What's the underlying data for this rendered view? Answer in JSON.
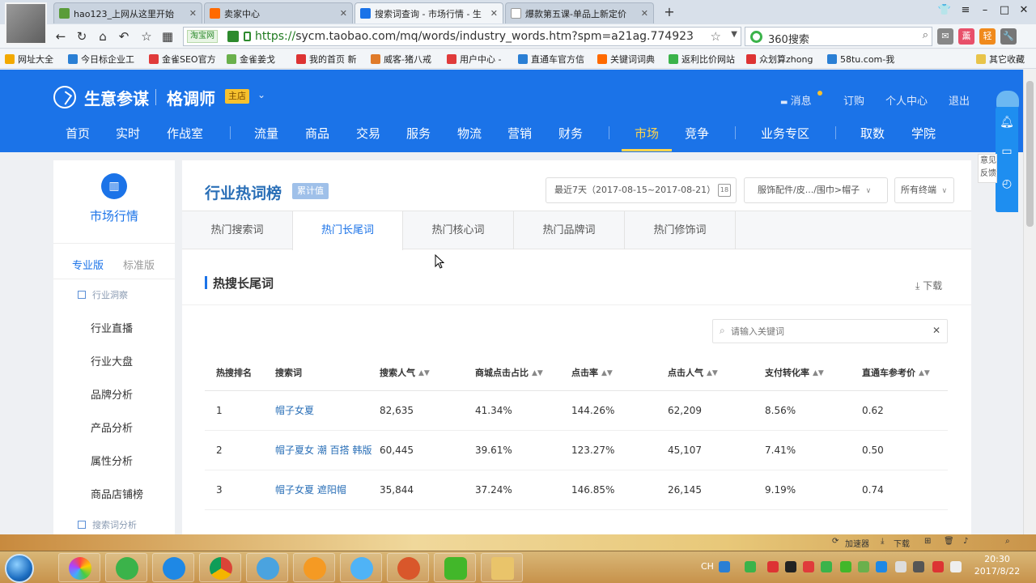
{
  "browser": {
    "tabs": [
      {
        "label": "hao123_上网从这里开始",
        "active": false,
        "favicon_color": "#5a9c3a"
      },
      {
        "label": "卖家中心",
        "active": false,
        "favicon_color": "#ff6a00"
      },
      {
        "label": "搜索词查询 - 市场行情 - 生",
        "active": true,
        "favicon_color": "#1b73e8"
      },
      {
        "label": "爆款第五课-单品上新定价",
        "active": false,
        "favicon_color": "#ffffff"
      }
    ],
    "url_tag": "淘宝网",
    "url_secure": "https://",
    "url_rest": "sycm.taobao.com/mq/words/industry_words.htm?spm=a21ag.774923",
    "search_engine": "360搜索",
    "bookmarks": [
      "网址大全",
      "今日标企业工",
      "金雀SEO官方",
      "金雀姜戈",
      "我的首页 新",
      "威客-猪八戒",
      "用户中心 -",
      "直通车官方信",
      "关键词词典",
      "返利比价网站",
      "众划算zhong",
      "58tu.com-我",
      "其它收藏"
    ]
  },
  "header": {
    "brand": "生意参谋",
    "shop_name": "格调师",
    "shop_badge": "主店",
    "links": {
      "message": "消息",
      "subscribe": "订购",
      "profile": "个人中心",
      "logout": "退出"
    },
    "nav": [
      "首页",
      "实时",
      "作战室",
      "流量",
      "商品",
      "交易",
      "服务",
      "物流",
      "营销",
      "财务",
      "市场",
      "竞争",
      "业务专区",
      "取数",
      "学院"
    ],
    "active_nav": "市场"
  },
  "sidebar": {
    "title": "市场行情",
    "version_pro": "专业版",
    "version_std": "标准版",
    "group1": "行业洞察",
    "items": [
      "行业直播",
      "行业大盘",
      "品牌分析",
      "产品分析",
      "属性分析",
      "商品店铺榜"
    ],
    "group2": "搜索词分析"
  },
  "main": {
    "title": "行业热词榜",
    "title_badge": "累计值",
    "date_range": "最近7天（2017-08-15~2017-08-21）",
    "category": "服饰配件/皮.../围巾>帽子",
    "terminal": "所有终端",
    "tabs": [
      "热门搜索词",
      "热门长尾词",
      "热门核心词",
      "热门品牌词",
      "热门修饰词"
    ],
    "active_tab": "热门长尾词",
    "section_title": "热搜长尾词",
    "download": "下载",
    "search_placeholder": "请输入关键词"
  },
  "table": {
    "headers": [
      "热搜排名",
      "搜索词",
      "搜索人气",
      "商城点击占比",
      "点击率",
      "点击人气",
      "支付转化率",
      "直通车参考价"
    ],
    "rows": [
      [
        "1",
        "帽子女夏",
        "82,635",
        "41.34%",
        "144.26%",
        "62,209",
        "8.56%",
        "0.62"
      ],
      [
        "2",
        "帽子夏女 潮 百搭 韩版",
        "60,445",
        "39.61%",
        "123.27%",
        "45,107",
        "7.41%",
        "0.50"
      ],
      [
        "3",
        "帽子女夏 遮阳帽",
        "35,844",
        "37.24%",
        "146.85%",
        "26,145",
        "9.19%",
        "0.74"
      ]
    ]
  },
  "float_panel": {
    "feedback": "意见反馈"
  },
  "statusbar": {
    "accelerator": "加速器",
    "download": "下载"
  },
  "taskbar": {
    "clock_time": "20:30",
    "clock_date": "2017/8/22",
    "lang": "CH"
  },
  "colors": {
    "brand_blue": "#1b73e8",
    "active_nav": "#ffd44c",
    "badge_yellow": "#f7c12e"
  }
}
